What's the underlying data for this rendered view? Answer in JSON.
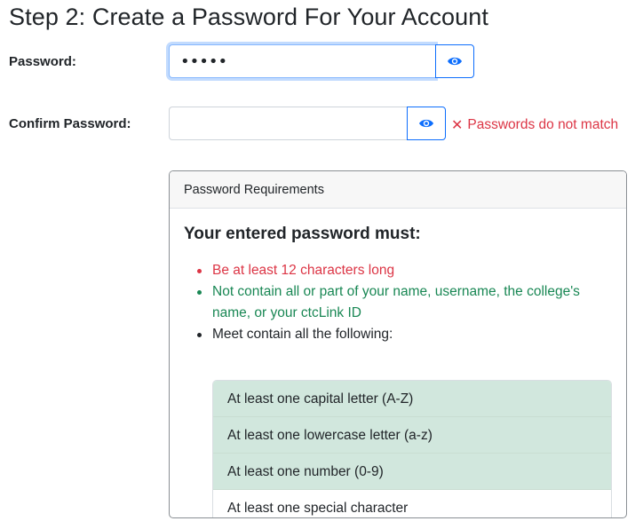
{
  "page": {
    "title": "Step 2: Create a Password For Your Account"
  },
  "password": {
    "label": "Password:",
    "value": "•••••"
  },
  "confirm": {
    "label": "Confirm Password:",
    "value": "",
    "error_icon": "✕",
    "error_text": "Passwords do not match"
  },
  "requirements": {
    "header": "Password Requirements",
    "heading": "Your entered password must:",
    "items": [
      {
        "text": "Be at least 12 characters long",
        "status": "unmet"
      },
      {
        "text": "Not contain all or part of your name, username, the college's name, or your ctcLink ID",
        "status": "met"
      },
      {
        "text": "Meet contain all the following:",
        "status": "neutral"
      }
    ],
    "sub_items": [
      {
        "text": "At least one capital letter (A-Z)",
        "met": true
      },
      {
        "text": "At least one lowercase letter (a-z)",
        "met": true
      },
      {
        "text": "At least one number (0-9)",
        "met": true
      },
      {
        "text": "At least one special character",
        "met": false
      }
    ]
  },
  "icons": {
    "show_password": "eye-icon",
    "error": "x-icon"
  },
  "colors": {
    "primary": "#0d6efd",
    "error": "#dc3545",
    "success": "#198754",
    "success_bg": "#d1e7dd"
  }
}
